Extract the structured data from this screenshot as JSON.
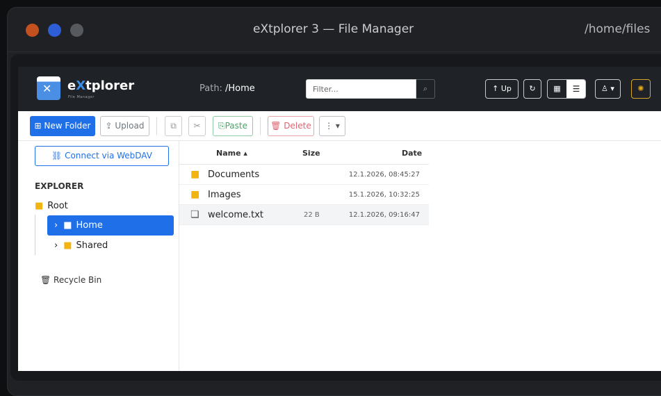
{
  "window": {
    "title": "eXtplorer 3 — File Manager",
    "path": "/home/files"
  },
  "app": {
    "brand": {
      "prefix": "e",
      "highlight": "X",
      "rest": "tplorer",
      "subtitle": "File Manager"
    },
    "path_label": "Path:",
    "path_value": "/Home",
    "filter_placeholder": "Filter...",
    "up_label": "↑ Up",
    "icons": {
      "search": "⌕",
      "refresh": "↻",
      "grid": "▦",
      "list": "☰",
      "user": "♙ ▾",
      "settings": "✺"
    }
  },
  "toolbar": {
    "new_folder": "⊞ New Folder",
    "upload": "⇪ Upload",
    "copy": "⧉",
    "cut": "✂",
    "paste": "⎘Paste",
    "delete": "🗑 Delete",
    "more": "⋮ ▾"
  },
  "sidebar": {
    "webdav": "⛓ Connect via WebDAV",
    "section": "EXPLORER",
    "root": "Root",
    "home": "Home",
    "shared": "Shared",
    "recycle": "🗑 Recycle Bin",
    "chevron": "›",
    "folder_icon": "■"
  },
  "filelist": {
    "headers": {
      "name": "Name ▴",
      "size": "Size",
      "date": "Date"
    },
    "rows": [
      {
        "name": "Documents",
        "size": "",
        "date": "12.1.2026, 08:45:27",
        "type": "folder"
      },
      {
        "name": "Images",
        "size": "",
        "date": "15.1.2026, 10:32:25",
        "type": "folder"
      },
      {
        "name": "welcome.txt",
        "size": "22 B",
        "date": "12.1.2026, 09:16:47",
        "type": "file"
      }
    ]
  }
}
